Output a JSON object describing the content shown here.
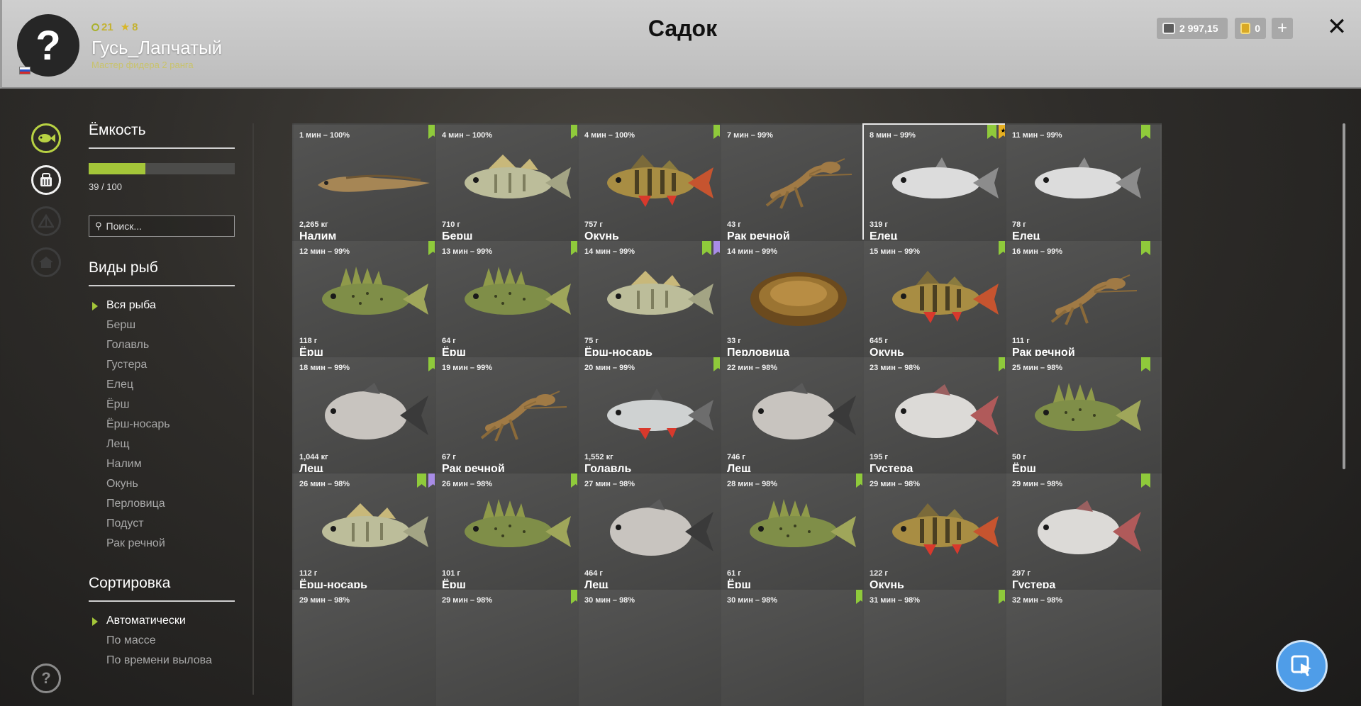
{
  "header": {
    "title": "Садок",
    "player": {
      "level": "21",
      "stars": "8",
      "name": "Гусь_Лапчатый",
      "rank": "Мастер фидера 2 ранга"
    },
    "silver": "2 997,15",
    "gold": "0",
    "plus_label": "+",
    "close_label": "✕",
    "avatar_glyph": "?"
  },
  "sidebar": {
    "capacity_title": "Ёмкость",
    "capacity_text": "39 / 100",
    "capacity_fill": 0.39,
    "search_placeholder": "Поиск...",
    "species_title": "Виды рыб",
    "species": [
      "Вся рыба",
      "Берш",
      "Голавль",
      "Густера",
      "Елец",
      "Ёрш",
      "Ёрш-носарь",
      "Лещ",
      "Налим",
      "Окунь",
      "Перловица",
      "Подуст",
      "Рак речной"
    ],
    "sort_title": "Сортировка",
    "sort_options": [
      "Автоматически",
      "По массе",
      "По времени вылова"
    ]
  },
  "catch": [
    {
      "time": "1 мин – 100%",
      "weight": "2,265 кг",
      "name": "Налим",
      "marks": [
        "green"
      ],
      "kind": "burbot"
    },
    {
      "time": "4 мин – 100%",
      "weight": "710 г",
      "name": "Берш",
      "marks": [
        "green"
      ],
      "kind": "zander"
    },
    {
      "time": "4 мин – 100%",
      "weight": "757 г",
      "name": "Окунь",
      "marks": [
        "green"
      ],
      "kind": "perch"
    },
    {
      "time": "7 мин – 99%",
      "weight": "43 г",
      "name": "Рак речной",
      "marks": [],
      "kind": "crayfish"
    },
    {
      "time": "8 мин – 99%",
      "weight": "319 г",
      "name": "Елец",
      "marks": [
        "green",
        "gold"
      ],
      "kind": "dace",
      "selected": true
    },
    {
      "time": "11 мин – 99%",
      "weight": "78 г",
      "name": "Елец",
      "marks": [
        "green"
      ],
      "kind": "dace"
    },
    {
      "time": "12 мин – 99%",
      "weight": "118 г",
      "name": "Ёрш",
      "marks": [
        "green"
      ],
      "kind": "ruffe"
    },
    {
      "time": "13 мин – 99%",
      "weight": "64 г",
      "name": "Ёрш",
      "marks": [
        "green"
      ],
      "kind": "ruffe"
    },
    {
      "time": "14 мин – 99%",
      "weight": "75 г",
      "name": "Ёрш-носарь",
      "marks": [
        "green",
        "purple"
      ],
      "kind": "zander"
    },
    {
      "time": "14 мин – 99%",
      "weight": "33 г",
      "name": "Перловица",
      "marks": [],
      "kind": "mussel"
    },
    {
      "time": "15 мин – 99%",
      "weight": "645 г",
      "name": "Окунь",
      "marks": [
        "green"
      ],
      "kind": "perch"
    },
    {
      "time": "16 мин – 99%",
      "weight": "111 г",
      "name": "Рак речной",
      "marks": [
        "green"
      ],
      "kind": "crayfish"
    },
    {
      "time": "18 мин – 99%",
      "weight": "1,044 кг",
      "name": "Лещ",
      "marks": [
        "green"
      ],
      "kind": "bream"
    },
    {
      "time": "19 мин – 99%",
      "weight": "67 г",
      "name": "Рак речной",
      "marks": [],
      "kind": "crayfish"
    },
    {
      "time": "20 мин – 99%",
      "weight": "1,552 кг",
      "name": "Голавль",
      "marks": [
        "green"
      ],
      "kind": "chub"
    },
    {
      "time": "22 мин – 98%",
      "weight": "746 г",
      "name": "Лещ",
      "marks": [],
      "kind": "bream"
    },
    {
      "time": "23 мин – 98%",
      "weight": "195 г",
      "name": "Густера",
      "marks": [
        "green"
      ],
      "kind": "bream-red"
    },
    {
      "time": "25 мин – 98%",
      "weight": "50 г",
      "name": "Ёрш",
      "marks": [
        "green"
      ],
      "kind": "ruffe"
    },
    {
      "time": "26 мин – 98%",
      "weight": "112 г",
      "name": "Ёрш-носарь",
      "marks": [
        "green",
        "purple"
      ],
      "kind": "zander"
    },
    {
      "time": "26 мин – 98%",
      "weight": "101 г",
      "name": "Ёрш",
      "marks": [
        "green"
      ],
      "kind": "ruffe"
    },
    {
      "time": "27 мин – 98%",
      "weight": "464 г",
      "name": "Лещ",
      "marks": [],
      "kind": "bream"
    },
    {
      "time": "28 мин – 98%",
      "weight": "61 г",
      "name": "Ёрш",
      "marks": [
        "green"
      ],
      "kind": "ruffe"
    },
    {
      "time": "29 мин – 98%",
      "weight": "122 г",
      "name": "Окунь",
      "marks": [],
      "kind": "perch"
    },
    {
      "time": "29 мин – 98%",
      "weight": "297 г",
      "name": "Густера",
      "marks": [
        "green"
      ],
      "kind": "bream-red"
    },
    {
      "time": "29 мин – 98%",
      "weight": "",
      "name": "",
      "marks": [],
      "kind": "none"
    },
    {
      "time": "29 мин – 98%",
      "weight": "",
      "name": "",
      "marks": [
        "green"
      ],
      "kind": "none"
    },
    {
      "time": "30 мин – 98%",
      "weight": "",
      "name": "",
      "marks": [],
      "kind": "none"
    },
    {
      "time": "30 мин – 98%",
      "weight": "",
      "name": "",
      "marks": [
        "green"
      ],
      "kind": "none"
    },
    {
      "time": "31 мин – 98%",
      "weight": "",
      "name": "",
      "marks": [
        "green"
      ],
      "kind": "none"
    },
    {
      "time": "32 мин – 98%",
      "weight": "",
      "name": "",
      "marks": [],
      "kind": "none"
    }
  ],
  "colors": {
    "accent": "#a4c639",
    "mark_green": "#8fca3b",
    "mark_purple": "#a88ce6",
    "mark_gold": "#e7b021"
  },
  "icons": {
    "sidebar": [
      "fish-icon",
      "basket-icon",
      "tent-icon",
      "home-icon",
      "help-icon"
    ],
    "floating": "cursor-icon"
  }
}
